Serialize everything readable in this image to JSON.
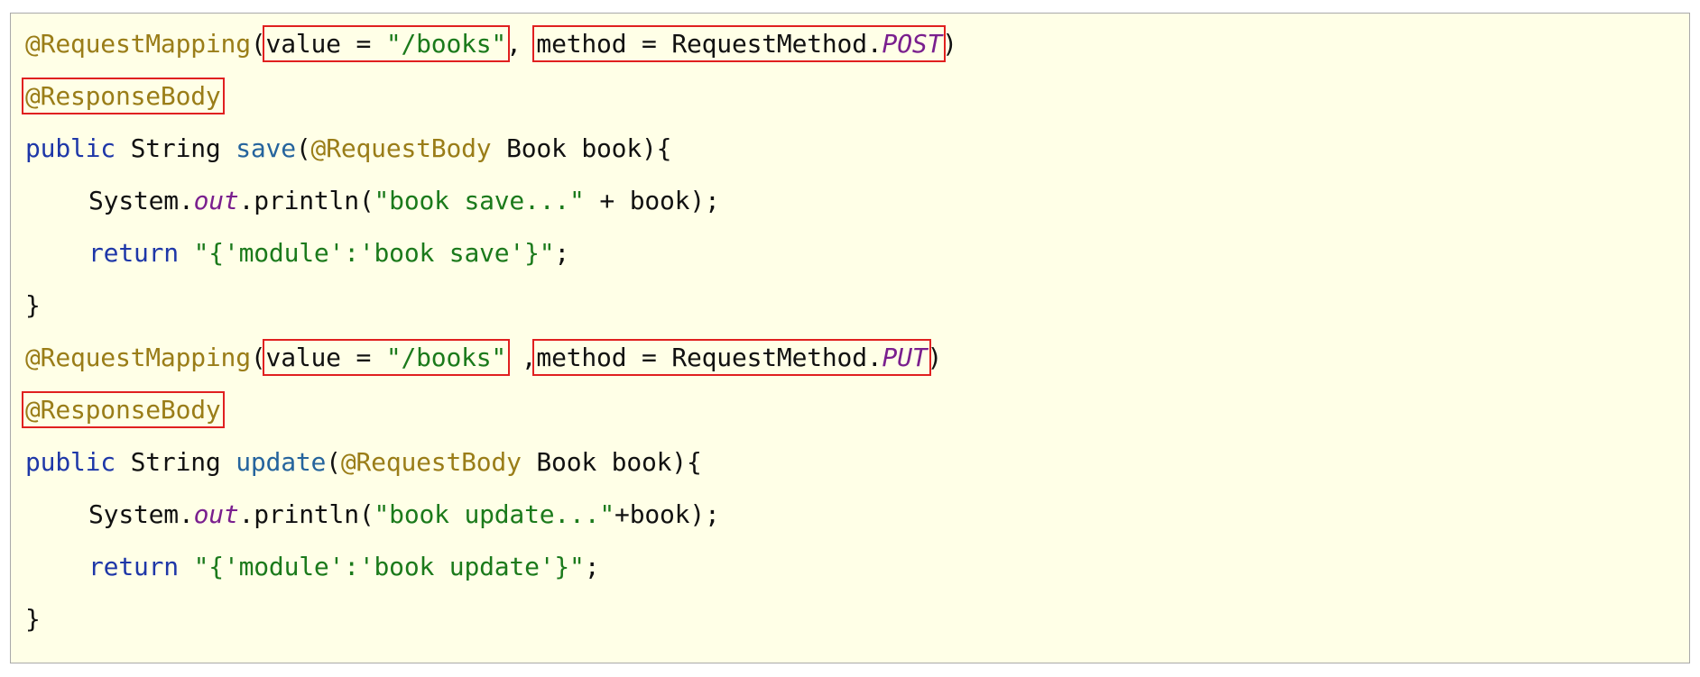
{
  "code": {
    "method_post_block": {
      "mapping_annotation": "@RequestMapping",
      "open_paren": "(",
      "value_key": "value = ",
      "value_literal": "\"/books\"",
      "separator": ", ",
      "method_key": "method = RequestMethod.",
      "method_const": "POST",
      "close_paren": ")",
      "response_body": "@ResponseBody",
      "sig_public": "public",
      "sig_type": " String ",
      "sig_name": "save",
      "sig_paren": "(",
      "sig_param_anno": "@RequestBody",
      "sig_param_rest": " Book book){",
      "print_obj": "System.",
      "print_field": "out",
      "print_call": ".println(",
      "print_literal": "\"book save...\"",
      "print_rest": " + book);",
      "return_kw": "return",
      "return_space": " ",
      "return_literal": "\"{'module':'book save'}\"",
      "return_end": ";",
      "close_brace": "}"
    },
    "method_put_block": {
      "mapping_annotation": "@RequestMapping",
      "open_paren": "(",
      "value_key": "value = ",
      "value_literal": "\"/books\"",
      "separator": " ,",
      "method_key": "method = RequestMethod.",
      "method_const": "PUT",
      "close_paren": ")",
      "response_body": "@ResponseBody",
      "sig_public": "public",
      "sig_type": " String ",
      "sig_name": "update",
      "sig_paren": "(",
      "sig_param_anno": "@RequestBody",
      "sig_param_rest": " Book book){",
      "print_obj": "System.",
      "print_field": "out",
      "print_call": ".println(",
      "print_literal": "\"book update...\"",
      "print_rest": "+book);",
      "return_kw": "return",
      "return_space": " ",
      "return_literal": "\"{'module':'book update'}\"",
      "return_end": ";",
      "close_brace": "}"
    }
  },
  "colors": {
    "background": "#ffffe7",
    "annotation": "#9a7d18",
    "keyword": "#1e37a8",
    "method_name": "#25649d",
    "string": "#1b7a1b",
    "static_field": "#7a1f8e",
    "highlight_box": "#e02020"
  }
}
